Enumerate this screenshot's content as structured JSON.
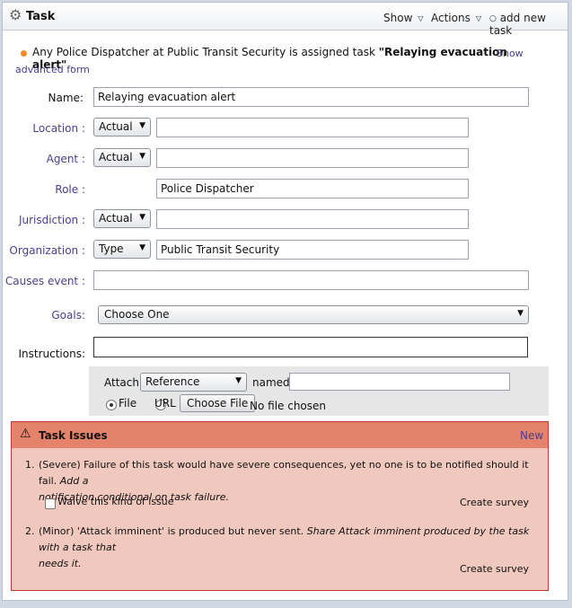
{
  "header": {
    "title": "Task",
    "show_label": "Show",
    "actions_label": "Actions",
    "add_new_task_label": "add new task"
  },
  "summary": {
    "text_prefix": "Any Police Dispatcher at Public Transit Security is assigned task ",
    "task_name": "\"Relaying evacuation alert\"",
    "text_suffix": " .",
    "show_advanced_line1": "Show",
    "show_advanced_line2": "advanced form"
  },
  "form": {
    "name_label": "Name:",
    "name_value": "Relaying evacuation alert",
    "location_label": "Location :",
    "location_select": "Actual",
    "location_value": "",
    "agent_label": "Agent :",
    "agent_select": "Actual",
    "agent_value": "",
    "role_label": "Role :",
    "role_value": "Police Dispatcher",
    "jurisdiction_label": "Jurisdiction :",
    "jurisdiction_select": "Actual",
    "jurisdiction_value": "",
    "organization_label": "Organization :",
    "organization_select": "Type",
    "organization_value": "Public Transit Security",
    "causes_event_label": "Causes event :",
    "causes_event_value": "",
    "goals_label": "Goals:",
    "goals_select": "Choose One",
    "instructions_label": "Instructions:",
    "instructions_value": ""
  },
  "attach": {
    "attach_label": "Attach:",
    "attach_select": "Reference",
    "named_label": "named",
    "named_value": "",
    "file_label": "File",
    "url_label": "URL",
    "choose_file_label": "Choose File",
    "no_file_label": "No file chosen"
  },
  "issues": {
    "title": "Task Issues",
    "new_label": "New",
    "items": [
      {
        "number": "1.",
        "text": "(Severe) Failure of this task would have severe consequences, yet no one is to be notified should it fail.",
        "remedy_line1": "Add a",
        "remedy_line2": "notification conditional on task failure.",
        "waive_label": "Waive this kind of issue",
        "survey_label": "Create survey"
      },
      {
        "number": "2.",
        "text": "(Minor) 'Attack imminent' is produced but never sent.",
        "remedy_line1": "Share Attack imminent produced by the task with a task that",
        "remedy_line2": "needs it.",
        "survey_label": "Create survey"
      }
    ]
  },
  "colors": {
    "link": "#4a3e8f",
    "issue_header": "#e4836b",
    "issue_body": "#f1c8be",
    "status_dot": "#f08a2a"
  }
}
